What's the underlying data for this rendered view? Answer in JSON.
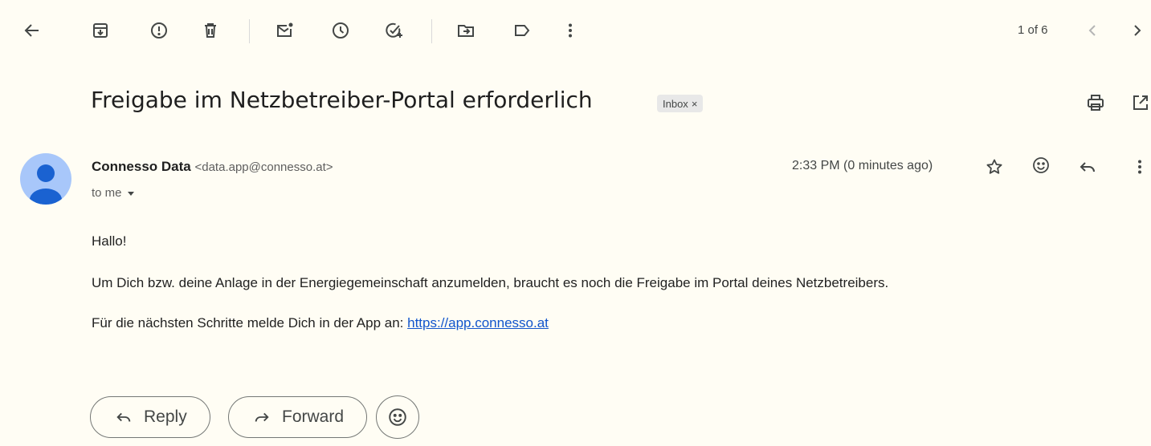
{
  "toolbar": {
    "icons": [
      "back-arrow-icon",
      "archive-icon",
      "report-spam-icon",
      "delete-icon",
      "mark-unread-icon",
      "snooze-icon",
      "add-task-icon",
      "move-to-icon",
      "labels-icon",
      "more-vert-icon"
    ],
    "pager_text": "1 of 6",
    "pager_icons": [
      "chevron-left-icon",
      "chevron-right-icon"
    ]
  },
  "subject": {
    "title": "Freigabe im Netzbetreiber-Portal erforderlich",
    "label": "Inbox",
    "label_close": "×",
    "icons": [
      "print-icon",
      "open-new-window-icon"
    ]
  },
  "message": {
    "sender_name": "Connesso Data",
    "sender_email": "<data.app@connesso.at>",
    "to": "to me",
    "time": "2:33 PM (0 minutes ago)",
    "header_icons": [
      "star-icon",
      "emoji-reaction-icon",
      "reply-icon",
      "more-vert-icon"
    ],
    "body": {
      "greeting": "Hallo!",
      "paragraph1": "Um Dich bzw. deine Anlage in der Energiegemeinschaft anzumelden, braucht es noch die Freigabe im Portal deines Netzbetreibers.",
      "paragraph2_prefix": "Für die nächsten Schritte melde Dich in der App an: ",
      "link_text": "https://app.connesso.at"
    }
  },
  "actions": {
    "reply_label": "Reply",
    "forward_label": "Forward",
    "emoji_icon": "emoji-reaction-icon"
  },
  "colors": {
    "background": "#fffdf4",
    "avatar": "#a8c7fa",
    "link": "#1155cc"
  }
}
